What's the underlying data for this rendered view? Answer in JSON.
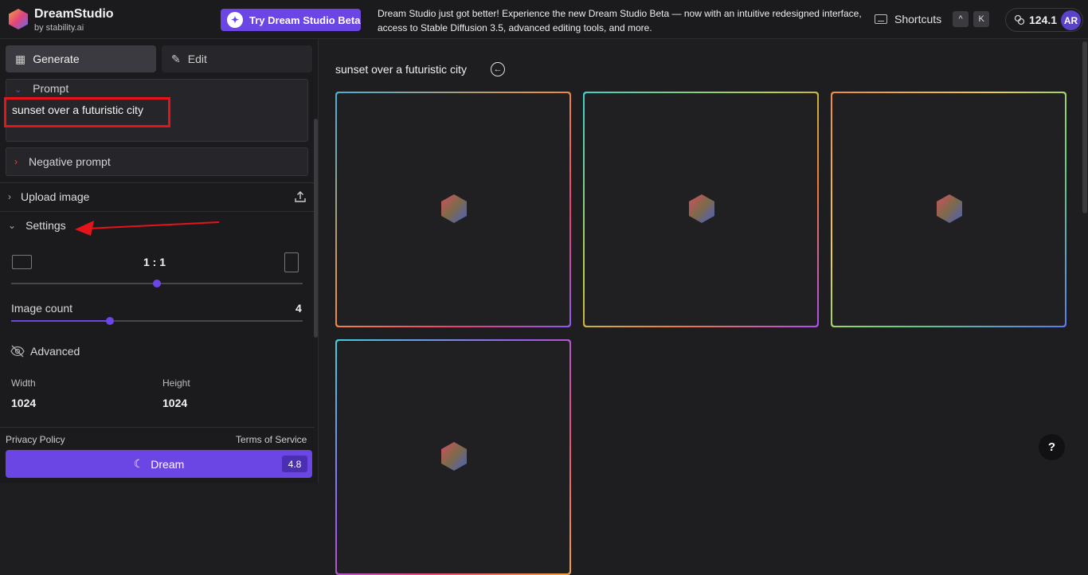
{
  "header": {
    "brand": "DreamStudio",
    "brand_sub": "by stability.ai",
    "beta_button": "Try Dream Studio Beta",
    "announcement": "Dream Studio just got better! Experience the new Dream Studio Beta — now with an intuitive redesigned interface, access to Stable Diffusion 3.5, advanced editing tools, and more.",
    "shortcuts_label": "Shortcuts",
    "shortcut_keys": [
      "^",
      "K"
    ],
    "credits": "124.1",
    "avatar_initials": "AR"
  },
  "sidebar": {
    "tabs": {
      "generate": "Generate",
      "edit": "Edit"
    },
    "prompt_label": "Prompt",
    "prompt_text": "sunset over a futuristic city",
    "negative_prompt_label": "Negative prompt",
    "upload_label": "Upload image",
    "settings_label": "Settings",
    "aspect_ratio": "1 : 1",
    "aspect_slider_fraction": 0.5,
    "image_count_label": "Image count",
    "image_count": "4",
    "image_count_fraction": 0.34,
    "advanced_label": "Advanced",
    "width_label": "Width",
    "width_value": "1024",
    "height_label": "Height",
    "height_value": "1024",
    "privacy_link": "Privacy Policy",
    "terms_link": "Terms of Service",
    "dream_button": "Dream",
    "dream_cost": "4.8"
  },
  "main": {
    "title": "sunset over a futuristic city",
    "help": "?"
  },
  "colors": {
    "accent": "#6b46e5",
    "highlight_red": "#e5141b"
  }
}
